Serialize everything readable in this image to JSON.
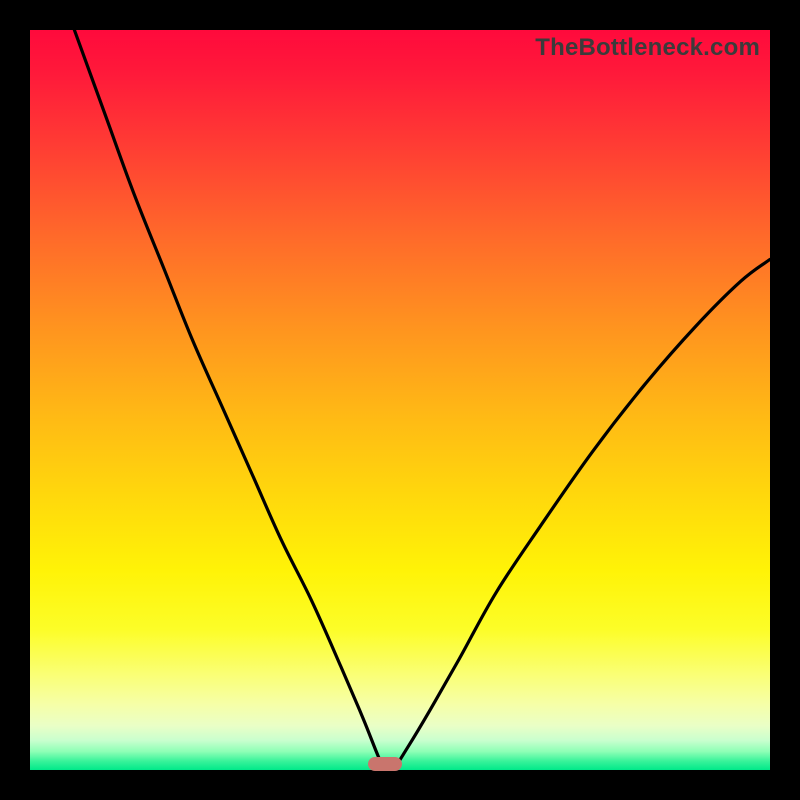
{
  "watermark": "TheBottleneck.com",
  "colors": {
    "frame": "#000000",
    "gradient_top": "#ff0a3c",
    "gradient_mid": "#fff307",
    "gradient_bottom": "#00e98a",
    "curve": "#000000",
    "marker": "#c9756d"
  },
  "chart_data": {
    "type": "line",
    "title": "",
    "xlabel": "",
    "ylabel": "",
    "xlim": [
      0,
      100
    ],
    "ylim": [
      0,
      100
    ],
    "marker": {
      "x": 48,
      "y": 0,
      "width_pct": 4.6
    },
    "series": [
      {
        "name": "left-branch",
        "x": [
          6,
          10,
          14,
          18,
          22,
          26,
          30,
          34,
          38,
          42,
          45,
          47,
          48
        ],
        "y": [
          100,
          89,
          78,
          68,
          58,
          49,
          40,
          31,
          23,
          14,
          7,
          2,
          0
        ]
      },
      {
        "name": "right-branch",
        "x": [
          49,
          51,
          54,
          58,
          63,
          69,
          76,
          83,
          90,
          96,
          100
        ],
        "y": [
          0,
          3,
          8,
          15,
          24,
          33,
          43,
          52,
          60,
          66,
          69
        ]
      }
    ],
    "annotations": []
  }
}
